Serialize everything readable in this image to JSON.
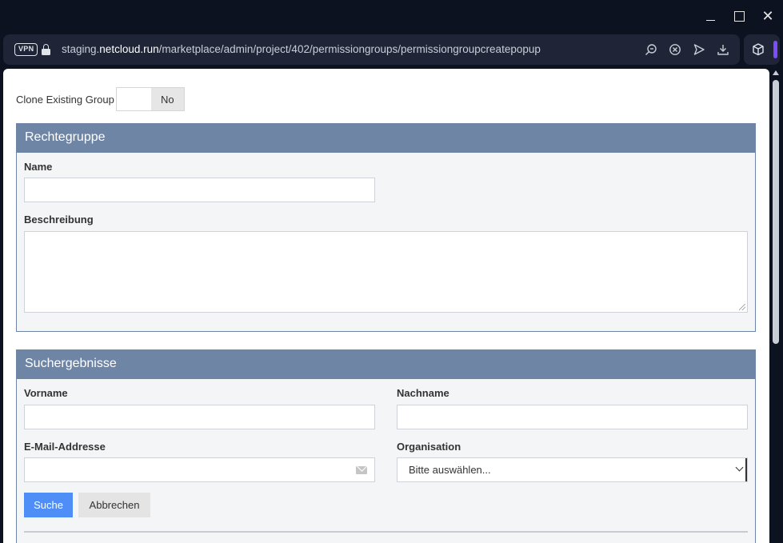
{
  "window": {
    "minimize_icon": "minimize-icon",
    "maximize_icon": "maximize-icon",
    "close_glyph": "✕"
  },
  "address_bar": {
    "vpn_label": "VPN",
    "url_prefix": "staging.",
    "url_host": "netcloud.run",
    "url_path": "/marketplace/admin/project/402/permissiongroups/permissiongroupcreatepopup"
  },
  "page": {
    "clone_label": "Clone Existing Group",
    "clone_state": "No",
    "group_panel": {
      "title": "Rechtegruppe",
      "name_label": "Name",
      "name_value": "",
      "description_label": "Beschreibung",
      "description_value": ""
    },
    "search_panel": {
      "title": "Suchergebnisse",
      "firstname_label": "Vorname",
      "firstname_value": "",
      "lastname_label": "Nachname",
      "lastname_value": "",
      "email_label": "E-Mail-Addresse",
      "email_value": "",
      "org_label": "Organisation",
      "org_selected": "Bitte auswählen...",
      "search_button": "Suche",
      "cancel_button": "Abbrechen"
    }
  },
  "colors": {
    "panel_header": "#6e85a6",
    "primary_button": "#4f8ef7",
    "browser_chrome": "#0d1220",
    "accent_bar": "#7c4dff"
  }
}
